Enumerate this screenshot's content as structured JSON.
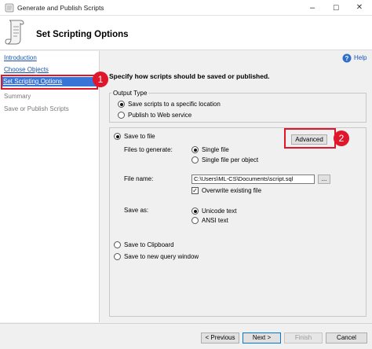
{
  "window": {
    "title": "Generate and Publish Scripts",
    "minimize": "–",
    "maximize": "☐",
    "close": "✕"
  },
  "header": {
    "title": "Set Scripting Options"
  },
  "sidebar": {
    "items": [
      {
        "label": "Introduction"
      },
      {
        "label": "Choose Objects"
      },
      {
        "label": "Set Scripting Options"
      },
      {
        "label": "Summary"
      },
      {
        "label": "Save or Publish Scripts"
      }
    ]
  },
  "help": {
    "label": "Help"
  },
  "content": {
    "instruction": "Specify how scripts should be saved or published.",
    "output_type": {
      "legend": "Output Type",
      "save_location": "Save scripts to a specific location",
      "publish_web": "Publish to Web service"
    },
    "save_to_file": "Save to file",
    "advanced_label": "Advanced",
    "files_to_generate": {
      "label": "Files to generate:",
      "single_file": "Single file",
      "single_per_object": "Single file per object"
    },
    "file_name": {
      "label": "File name:",
      "value": "C:\\Users\\ML-CS\\Documents\\script.sql",
      "browse": "..."
    },
    "overwrite": "Overwrite existing file",
    "save_as": {
      "label": "Save as:",
      "unicode": "Unicode text",
      "ansi": "ANSI text"
    },
    "save_clipboard": "Save to Clipboard",
    "save_query_window": "Save to new query window"
  },
  "callouts": {
    "one": "1",
    "two": "2"
  },
  "footer": {
    "previous": "< Previous",
    "next": "Next >",
    "finish": "Finish",
    "cancel": "Cancel"
  }
}
